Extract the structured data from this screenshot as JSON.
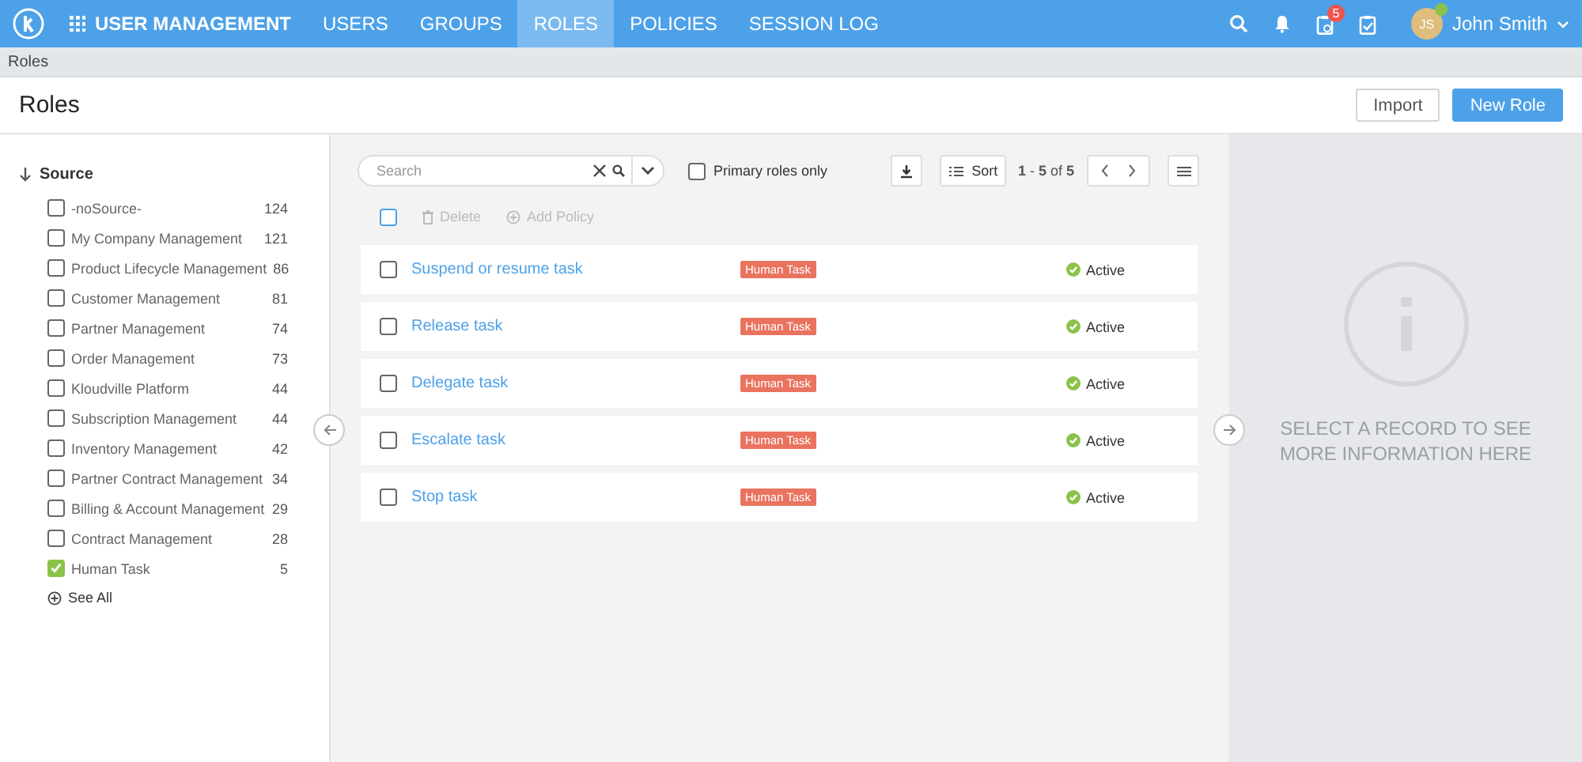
{
  "topbar": {
    "app_title": "USER MANAGEMENT",
    "nav": [
      {
        "label": "USERS",
        "selected": false
      },
      {
        "label": "GROUPS",
        "selected": false
      },
      {
        "label": "ROLES",
        "selected": true
      },
      {
        "label": "POLICIES",
        "selected": false
      },
      {
        "label": "SESSION LOG",
        "selected": false
      }
    ],
    "notification_count": "5",
    "user": {
      "initials": "JS",
      "name": "John Smith"
    }
  },
  "breadcrumb": "Roles",
  "page_title": "Roles",
  "buttons": [
    {
      "label": "Import",
      "kind": "secondary"
    },
    {
      "label": "New Role",
      "kind": "primary"
    }
  ],
  "sidebar": {
    "title": "Source",
    "items": [
      {
        "label": "-noSource-",
        "count": "124",
        "checked": false
      },
      {
        "label": "My Company Management",
        "count": "121",
        "checked": false
      },
      {
        "label": "Product Lifecycle Management",
        "count": "86",
        "checked": false
      },
      {
        "label": "Customer Management",
        "count": "81",
        "checked": false
      },
      {
        "label": "Partner Management",
        "count": "74",
        "checked": false
      },
      {
        "label": "Order Management",
        "count": "73",
        "checked": false
      },
      {
        "label": "Kloudville Platform",
        "count": "44",
        "checked": false
      },
      {
        "label": "Subscription Management",
        "count": "44",
        "checked": false
      },
      {
        "label": "Inventory Management",
        "count": "42",
        "checked": false
      },
      {
        "label": "Partner Contract Management",
        "count": "34",
        "checked": false
      },
      {
        "label": "Billing & Account Management",
        "count": "29",
        "checked": false
      },
      {
        "label": "Contract Management",
        "count": "28",
        "checked": false
      },
      {
        "label": "Human Task",
        "count": "5",
        "checked": true
      }
    ],
    "see_all": "See All"
  },
  "toolbar": {
    "search": {
      "placeholder": "Search"
    },
    "primary_only": {
      "label": "Primary roles only",
      "checked": false
    },
    "sort": "Sort",
    "pager": "**1** - **5** of **5**"
  },
  "bulk_actions": {
    "select_all_checked": false,
    "actions": [
      {
        "label": "Delete",
        "kind": "delete",
        "disabled": true
      },
      {
        "label": "Add Policy",
        "kind": "add",
        "disabled": true
      }
    ]
  },
  "rows": [
    {
      "name": "Suspend or resume task",
      "checked": false,
      "tag": "Human Task",
      "status": "Active"
    },
    {
      "name": "Release task",
      "checked": false,
      "tag": "Human Task",
      "status": "Active"
    },
    {
      "name": "Delegate task",
      "checked": false,
      "tag": "Human Task",
      "status": "Active"
    },
    {
      "name": "Escalate task",
      "checked": false,
      "tag": "Human Task",
      "status": "Active"
    },
    {
      "name": "Stop task",
      "checked": false,
      "tag": "Human Task",
      "status": "Active"
    }
  ],
  "info_panel": {
    "message": "SELECT A RECORD TO SEE MORE INFORMATION HERE"
  }
}
